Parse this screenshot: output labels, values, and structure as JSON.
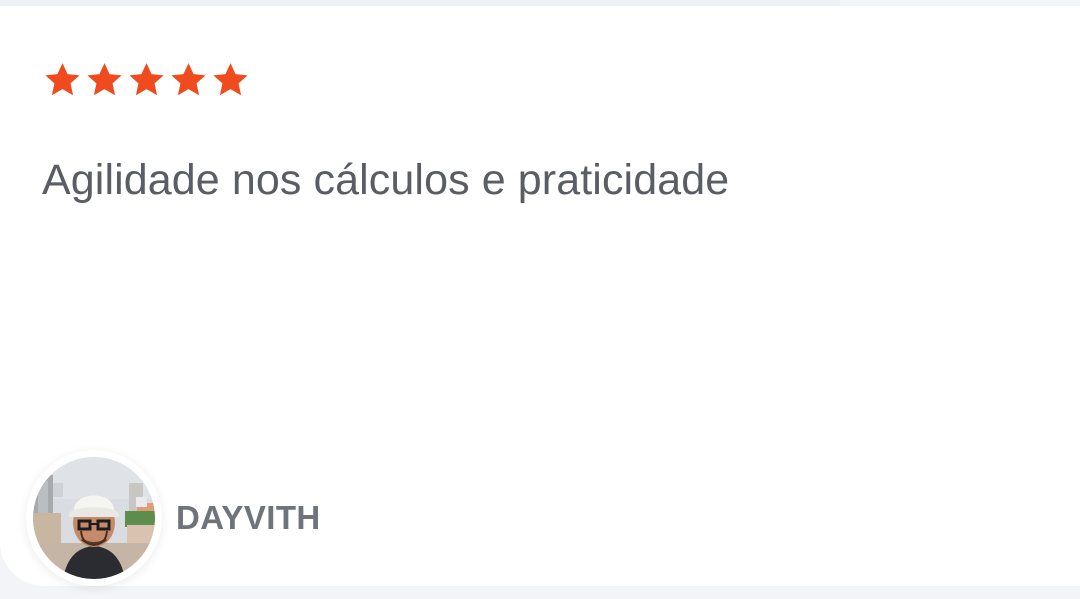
{
  "review": {
    "rating": 5,
    "max_rating": 5,
    "text": "Agilidade nos cálculos e praticidade",
    "author": "DAYVITH"
  },
  "theme": {
    "star_color": "#ef4b1f",
    "text_color": "#5a5d63",
    "name_color": "#6f747c"
  },
  "icons": {
    "star": "star-icon",
    "avatar": "avatar"
  }
}
